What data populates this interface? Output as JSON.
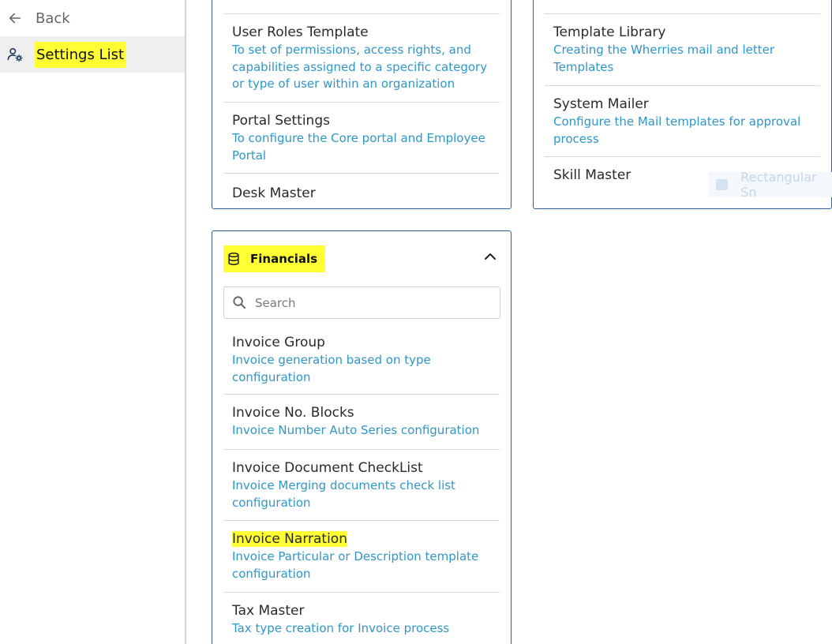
{
  "sidebar": {
    "back_label": "Back",
    "settings_label": "Settings List"
  },
  "top_left_card": {
    "items": [
      {
        "title": "User Roles Template",
        "description": "To set of permissions, access rights, and capabilities assigned to a specific category or type of user within an organization"
      },
      {
        "title": "Portal Settings",
        "description": "To configure the Core portal and Employee Portal"
      }
    ],
    "cut_off_item": "Desk Master"
  },
  "top_right_card": {
    "items": [
      {
        "title": "Template Library",
        "description": "Creating the Wherries mail and letter Templates"
      },
      {
        "title": "System Mailer",
        "description": "Configure the Mail templates for approval process"
      },
      {
        "title": "Skill Master",
        "description": ""
      }
    ]
  },
  "drag_ghost": {
    "label": "Rectangular Sn"
  },
  "financials": {
    "title": "Financials",
    "search_placeholder": "Search",
    "items": [
      {
        "title": "Invoice Group",
        "description": "Invoice generation based on type configuration"
      },
      {
        "title": "Invoice No. Blocks",
        "description": "Invoice Number Auto Series configuration"
      },
      {
        "title": "Invoice Document CheckList",
        "description": "Invoice Merging documents check list configuration"
      },
      {
        "title": "Invoice Narration",
        "description": "Invoice Particular or Description template configuration"
      },
      {
        "title": "Tax Master",
        "description": "Tax type creation for Invoice process"
      }
    ]
  },
  "colors": {
    "highlight": "#ffff33",
    "link_blue": "#2f97c8",
    "card_border": "#2d5f9a"
  }
}
